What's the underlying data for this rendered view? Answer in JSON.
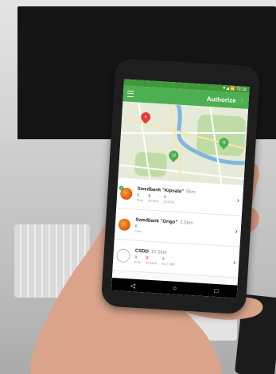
{
  "app": {
    "status_time": "▼◢ 📶 72:18",
    "appbar_title": "Authorize",
    "map_pins": [
      "6",
      "12",
      "11"
    ]
  },
  "stations": [
    {
      "name": "Swedbank \"Kipsala\"",
      "distance": "5km",
      "badge": "1",
      "stats": [
        {
          "value": "5",
          "sub": "Free",
          "color": "green"
        },
        {
          "value": "0",
          "sub": "55.00%",
          "color": "red"
        },
        {
          "value": "4",
          "sub": "82.00%",
          "color": "green"
        }
      ]
    },
    {
      "name": "Swedbank \"Origo\"",
      "distance": "2.5km",
      "badge": "",
      "stats": [
        {
          "value": "0",
          "sub": "Free",
          "color": "green"
        }
      ]
    },
    {
      "name": "CSDD",
      "distance": "12.5km",
      "badge": "",
      "stats": [
        {
          "value": "0",
          "sub": "Free",
          "color": "green"
        },
        {
          "value": "0",
          "sub": "49 km/h",
          "color": "red"
        },
        {
          "value": "4",
          "sub": "for 2.00/h",
          "color": "green"
        }
      ]
    }
  ],
  "icons": [
    "menu-icon",
    "kebab-icon",
    "chevron-right-icon",
    "bike-icon",
    "map-pin-icon",
    "back-icon",
    "home-icon",
    "recents-icon"
  ],
  "colors": {
    "brand": "#4caf50",
    "alert": "#e53935"
  }
}
